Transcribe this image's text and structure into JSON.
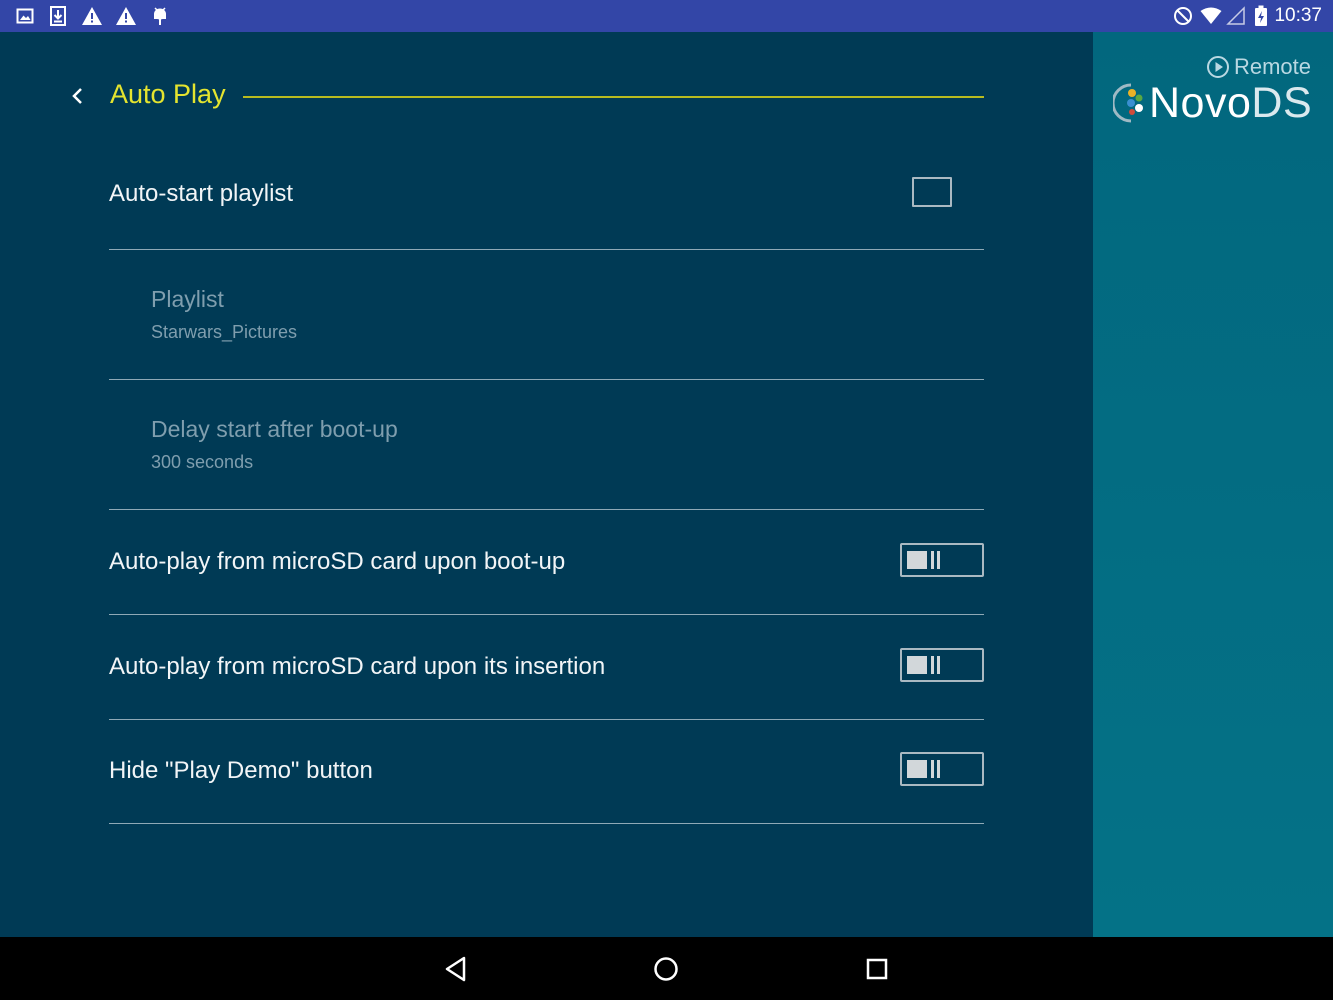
{
  "status_bar": {
    "time": "10:37",
    "left_icons": [
      "gallery-icon",
      "download-icon",
      "warning-icon",
      "warning-icon",
      "android-debug-icon"
    ],
    "right_icons": [
      "do-not-disturb-icon",
      "wifi-icon",
      "cell-signal-icon",
      "battery-charging-icon"
    ]
  },
  "header": {
    "title": "Auto Play",
    "back_icon": "chevron-left-icon",
    "accent_color": "#e4e42f"
  },
  "settings": [
    {
      "label": "Auto-start playlist",
      "control": "checkbox",
      "checked": false
    },
    {
      "label": "Playlist",
      "sub": "Starwars_Pictures",
      "enabled": false
    },
    {
      "label": "Delay start after boot-up",
      "sub": "300 seconds",
      "enabled": false
    },
    {
      "label": "Auto-play from microSD card upon boot-up",
      "control": "switch",
      "on": false
    },
    {
      "label": "Auto-play from microSD card upon its insertion",
      "control": "switch",
      "on": false
    },
    {
      "label": "Hide \"Play Demo\" button",
      "control": "switch",
      "on": false
    }
  ],
  "brand": {
    "remote_label": "Remote",
    "name_bold": "Novo",
    "name_thin": "DS"
  },
  "nav_bar": {
    "buttons": [
      "back-triangle-icon",
      "home-circle-icon",
      "recents-square-icon"
    ]
  }
}
